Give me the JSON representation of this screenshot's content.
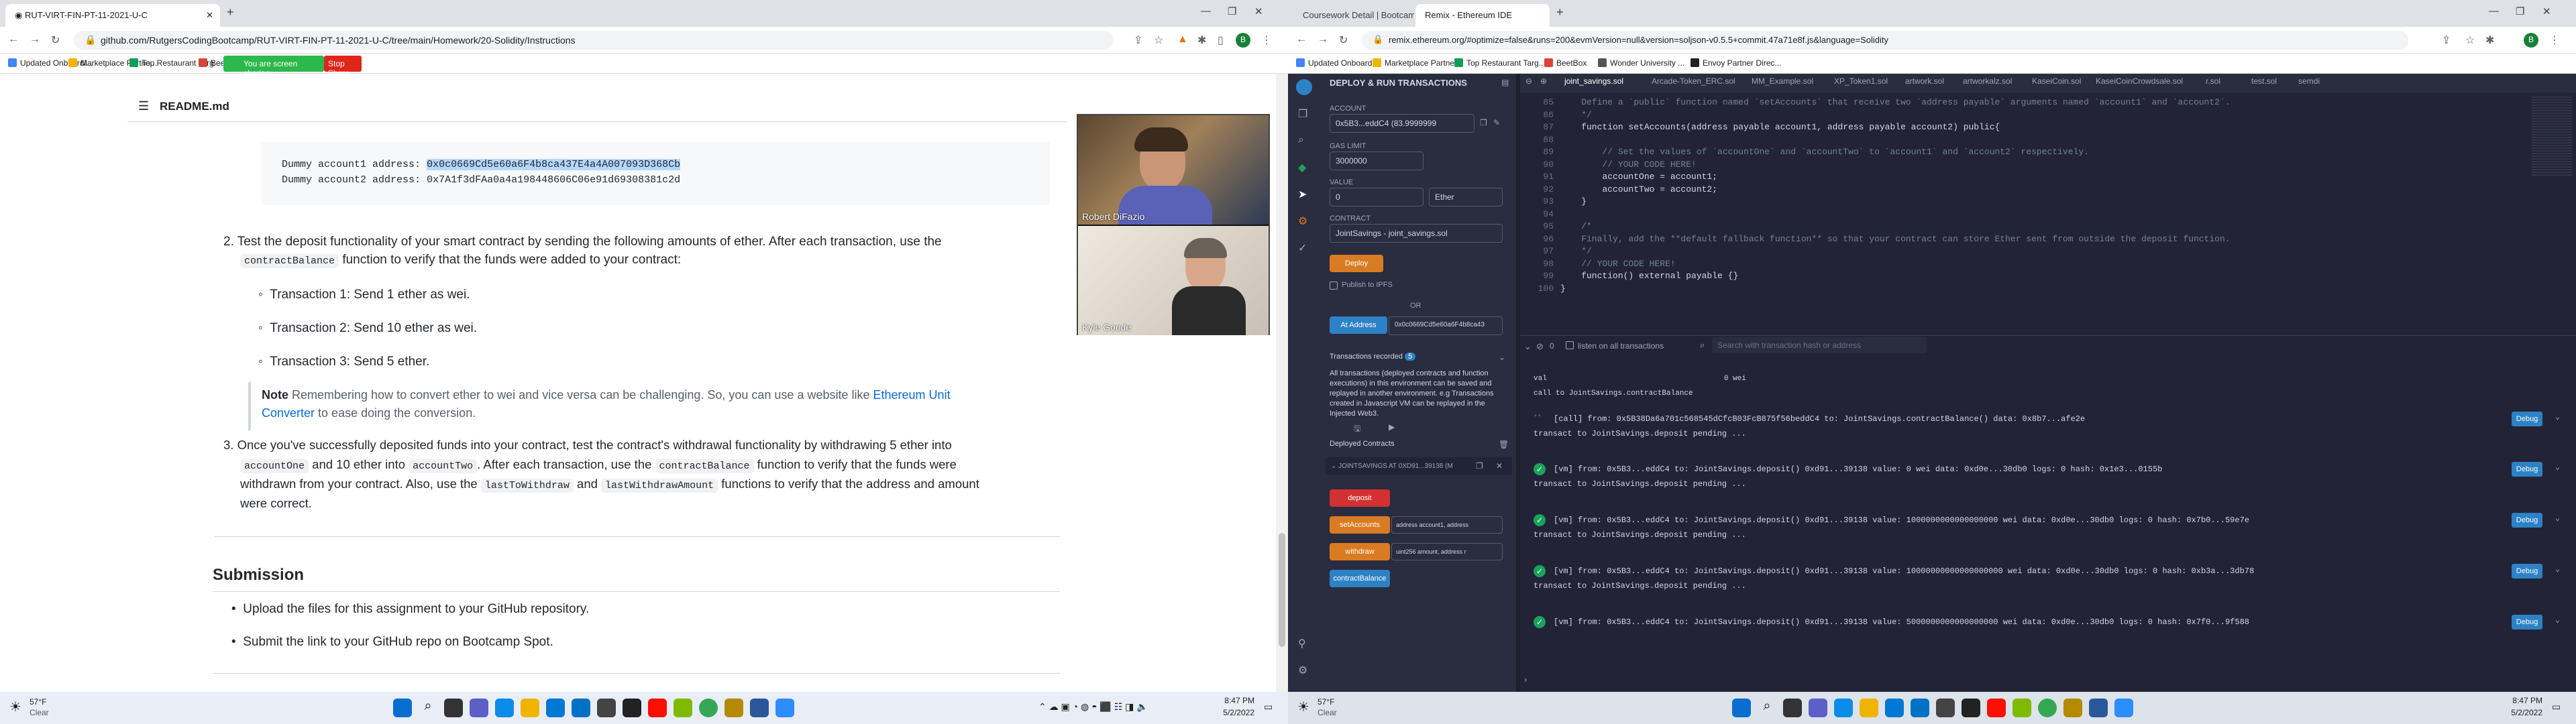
{
  "left_browser": {
    "tabs": [
      {
        "label": "RUT-VIRT-FIN-PT-11-2021-U-C",
        "active": true
      }
    ],
    "new_tab": "+",
    "url": "github.com/RutgersCodingBootcamp/RUT-VIRT-FIN-PT-11-2021-U-C/tree/main/Homework/20-Solidity/Instructions",
    "bookmarks": [
      "Updated Onboardi...",
      "Marketplace Partne...",
      "Top Restaurant Targ...",
      "BeetBox"
    ],
    "sharing_text": "You are screen sharing",
    "stop_share": "Stop Share",
    "profile_initial": "B"
  },
  "readme": {
    "file_title": "README.md",
    "code_line1_label": "Dummy account1 address:",
    "code_line1_value": "0x0c0669Cd5e60a6F4b8ca437E4a4A007093D368Cb",
    "code_line2_label": "Dummy account2 address:",
    "code_line2_value": "0x7A1f3dFAa0a4a198448606C06e91d69308381c2d",
    "item2_num": "2.",
    "item2_text": "Test the deposit functionality of your smart contract by sending the following amounts of ether. After each transaction, use the",
    "item2_code": "contractBalance",
    "item2_rest": "function to verify that the funds were added to your contract:",
    "transactions": [
      "Transaction 1: Send 1 ether as wei.",
      "Transaction 2: Send 10 ether as wei.",
      "Transaction 3: Send 5 ether."
    ],
    "note_bold": "Note",
    "note_text": "Remembering how to convert ether to wei and vice versa can be challenging. So, you can use a website like",
    "note_link": "Ethereum Unit",
    "note_link2": "Converter",
    "note_end": "to ease doing the conversion.",
    "item3_num": "3.",
    "item3_a": "Once you've successfully deposited funds into your contract, test the contract's withdrawal functionality by withdrawing 5 ether into",
    "item3_c1": "accountOne",
    "item3_b": "and 10 ether into",
    "item3_c2": "accountTwo",
    "item3_c": ". After each transaction, use the",
    "item3_c3": "contractBalance",
    "item3_d": "function to verify that the funds were",
    "item3_e": "withdrawn from your contract. Also, use the",
    "item3_c4": "lastToWithdraw",
    "item3_f": "and",
    "item3_c5": "lastWithdrawAmount",
    "item3_g": "functions to verify that the address and amount",
    "item3_h": "were correct.",
    "submission_heading": "Submission",
    "submission_items": [
      "Upload the files for this assignment to your GitHub repository.",
      "Submit the link to your GitHub repo on Bootcamp Spot."
    ]
  },
  "video": {
    "participants": [
      "Robert DiFazio",
      "Kyle Goode"
    ]
  },
  "left_taskbar": {
    "weather_temp": "57°F",
    "weather_desc": "Clear",
    "time": "8:47 PM",
    "date": "5/2/2022"
  },
  "right_browser": {
    "tabs": [
      {
        "label": "Coursework Detail | Bootcamp Sp",
        "active": false
      },
      {
        "label": "Remix - Ethereum IDE",
        "active": true
      }
    ],
    "url": "remix.ethereum.org/#optimize=false&runs=200&evmVersion=null&version=soljson-v0.5.5+commit.47a71e8f.js&language=Solidity",
    "bookmarks": [
      "Updated Onboardi...",
      "Marketplace Partne...",
      "Top Restaurant Targ...",
      "BeetBox",
      "Wonder University ...",
      "Envoy Partner Direc..."
    ]
  },
  "remix": {
    "panel_title": "DEPLOY & RUN TRANSACTIONS",
    "account_label": "ACCOUNT",
    "account_value": "0x5B3...eddC4 (83.9999999",
    "gas_label": "GAS LIMIT",
    "gas_value": "3000000",
    "value_label": "VALUE",
    "value_amount": "0",
    "value_unit": "Ether",
    "contract_label": "CONTRACT",
    "contract_value": "JointSavings - joint_savings.sol",
    "deploy_btn": "Deploy",
    "publish_ipfs": "Publish to IPFS",
    "or_text": "OR",
    "at_address_btn": "At Address",
    "at_address_value": "0x0c0669Cd5e60a6F4b8ca43",
    "tx_recorded": "Transactions recorded",
    "tx_recorded_count": "5",
    "tx_info": "All transactions (deployed contracts and function executions) in this environment can be saved and replayed in another environment. e.g Transactions created in Javascript VM can be replayed in the Injected Web3.",
    "deployed_contracts": "Deployed Contracts",
    "instance": "JOINTSAVINGS AT 0XD91...39138 (M",
    "fn_buttons": [
      {
        "label": "deposit",
        "color": "#d33131",
        "arg": ""
      },
      {
        "label": "setAccounts",
        "color": "#d97b22",
        "arg": "address account1, address"
      },
      {
        "label": "withdraw",
        "color": "#d97b22",
        "arg": "uint256 amount, address r"
      },
      {
        "label": "contractBalance",
        "color": "#2d82c5",
        "arg": ""
      }
    ],
    "file_tabs": [
      "joint_savings.sol",
      "Arcade-Token_ERC.sol",
      "MM_Example.sol",
      "XP_Token1.sol",
      "artwork.sol",
      "artworkalz.sol",
      "KaseiCoin.sol",
      "KaseiCoinCrowdsale.sol",
      "r.sol",
      "test.sol",
      "semdi"
    ],
    "line_numbers": [
      "85",
      "86",
      "87",
      "88",
      "89",
      "90",
      "91",
      "92",
      "93",
      "94",
      "95",
      "96",
      "97",
      "98",
      "99",
      "100"
    ],
    "code_lines": [
      {
        "t": "    Define a `public` function named `setAccounts` that receive two `address payable` arguments named `account1` and `account2`.",
        "c": "cm"
      },
      {
        "t": "    */",
        "c": "cm"
      },
      {
        "t": "    function setAccounts(address payable account1, address payable account2) public{",
        "c": ""
      },
      {
        "t": "",
        "c": ""
      },
      {
        "t": "        // Set the values of `accountOne` and `accountTwo` to `account1` and `account2` respectively.",
        "c": "cm"
      },
      {
        "t": "        // YOUR CODE HERE!",
        "c": "cm"
      },
      {
        "t": "        accountOne = account1;",
        "c": ""
      },
      {
        "t": "        accountTwo = account2;",
        "c": ""
      },
      {
        "t": "    }",
        "c": ""
      },
      {
        "t": "",
        "c": ""
      },
      {
        "t": "    /*",
        "c": "cm"
      },
      {
        "t": "    Finally, add the **default fallback function** so that your contract can store Ether sent from outside the deposit function.",
        "c": "cm"
      },
      {
        "t": "    */",
        "c": "cm"
      },
      {
        "t": "    // YOUR CODE HERE!",
        "c": "cm"
      },
      {
        "t": "    function() external payable {}",
        "c": ""
      },
      {
        "t": "}",
        "c": ""
      }
    ],
    "terminal_count": "0",
    "listen_label": "listen on all transactions",
    "search_placeholder": "Search with transaction hash or address",
    "term_val": "val",
    "term_val2": "0 wei",
    "term_call_line": "call to JointSavings.contractBalance",
    "term_call": "[call] from: 0x5B38Da6a701c568545dCfcB03FcB875f56beddC4 to: JointSavings.contractBalance() data: 0x8b7...afe2e",
    "term_call_sub": "transact to JointSavings.deposit pending ...",
    "tx_rows": [
      {
        "text": "[vm] from: 0x5B3...eddC4 to: JointSavings.deposit() 0xd91...39138 value: 0 wei data: 0xd0e...30db0 logs: 0 hash: 0x1e3...0155b",
        "sub": "transact to JointSavings.deposit pending ..."
      },
      {
        "text": "[vm] from: 0x5B3...eddC4 to: JointSavings.deposit() 0xd91...39138 value: 1000000000000000000 wei data: 0xd0e...30db0 logs: 0 hash: 0x7b0...59e7e",
        "sub": "transact to JointSavings.deposit pending ..."
      },
      {
        "text": "[vm] from: 0x5B3...eddC4 to: JointSavings.deposit() 0xd91...39138 value: 10000000000000000000 wei data: 0xd0e...30db0 logs: 0 hash: 0xb3a...3db78",
        "sub": "transact to JointSavings.deposit pending ..."
      },
      {
        "text": "[vm] from: 0x5B3...eddC4 to: JointSavings.deposit() 0xd91...39138 value: 5000000000000000000 wei data: 0xd0e...30db0 logs: 0 hash: 0x7f0...9f588",
        "sub": ""
      }
    ],
    "debug_label": "Debug"
  },
  "right_taskbar": {
    "weather_temp": "57°F",
    "weather_desc": "Clear",
    "time": "8:47 PM",
    "date": "5/2/2022"
  }
}
